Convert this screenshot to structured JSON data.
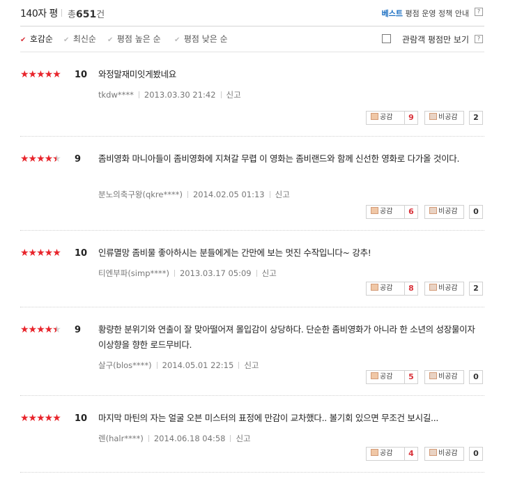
{
  "header": {
    "title": "140자 평",
    "total_prefix": "총",
    "total_count": "651",
    "total_suffix": "건",
    "best_label": "베스트",
    "policy_label": "평점 운영 정책 안내",
    "help_glyph": "?"
  },
  "sort": {
    "options": [
      "호감순",
      "최신순",
      "평점 높은 순",
      "평점 낮은 순"
    ],
    "active_index": 0,
    "viewers_only_label": "관람객 평점만 보기",
    "viewers_only_checked": false
  },
  "labels": {
    "like": "공감",
    "dislike": "비공감",
    "report": "신고"
  },
  "colors": {
    "star": "#e8242b",
    "accent_red": "#d9323a",
    "best_blue": "#1b6fc2"
  },
  "reviews": [
    {
      "stars": 5,
      "score": "10",
      "text": "와정말재미잇게봤네요",
      "user": "tkdw****",
      "date": "2013.03.30 21:42",
      "likes": "9",
      "dislikes": "2"
    },
    {
      "stars": 4.5,
      "score": "9",
      "text": "좀비영화 마니아들이 좀비영화에 지쳐갈 무렵 이 영화는 좀비랜드와 함께 신선한 영화로 다가올 것이다.",
      "user": "분노의축구왕(qkre****)",
      "date": "2014.02.05 01:13",
      "likes": "6",
      "dislikes": "0"
    },
    {
      "stars": 5,
      "score": "10",
      "text": "인류멸망 좀비물 좋아하시는 분들에게는 간만에 보는 멋진 수작입니다~ 강추!",
      "user": "티엔부파(simp****)",
      "date": "2013.03.17 05:09",
      "likes": "8",
      "dislikes": "2"
    },
    {
      "stars": 4.5,
      "score": "9",
      "text": "황량한 분위기와 연출이 잘 맞아떨어져 몰입감이 상당하다. 단순한 좀비영화가 아니라 한 소년의 성장물이자 이상향을 향한 로드무비다.",
      "user": "살구(blos****)",
      "date": "2014.05.01 22:15",
      "likes": "5",
      "dislikes": "0"
    },
    {
      "stars": 5,
      "score": "10",
      "text": "마지막 마틴의 자는 얼굴 오븐 미스터의 표정에 만감이 교차했다.. 볼기회 있으면 무조건 보시길...",
      "user": "렌(halr****)",
      "date": "2014.06.18 04:58",
      "likes": "4",
      "dislikes": "0"
    }
  ]
}
